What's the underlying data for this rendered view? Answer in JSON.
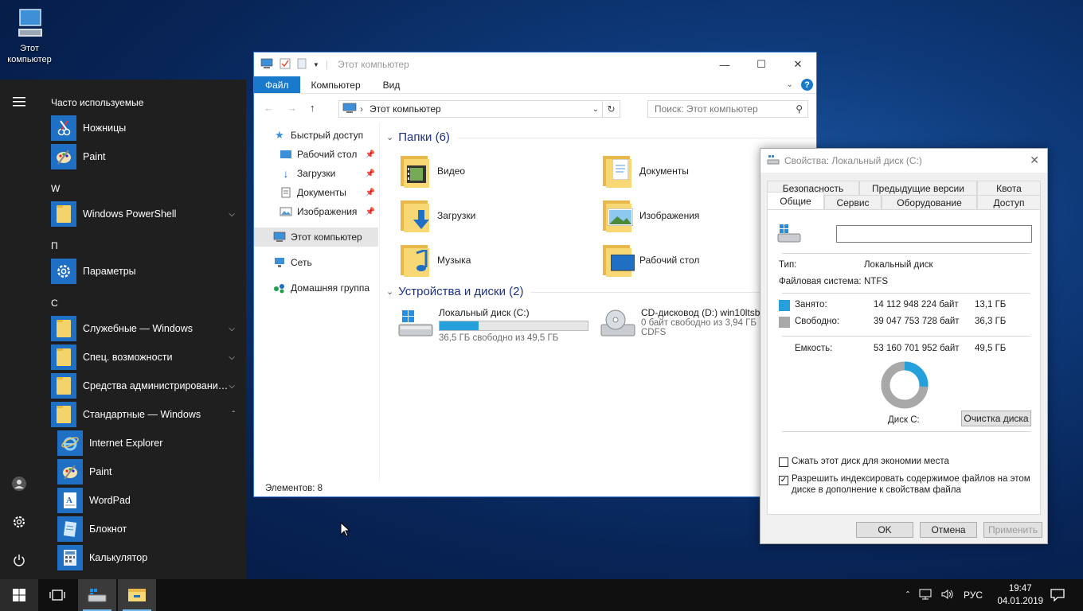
{
  "desktop": {
    "icon_label_1": "Этот",
    "icon_label_2": "компьютер"
  },
  "start_menu": {
    "header": "Часто используемые",
    "letters": [
      "W",
      "П",
      "С"
    ],
    "apps": [
      {
        "label": "Ножницы",
        "icon": "scissors-icon"
      },
      {
        "label": "Paint",
        "icon": "paint-icon"
      },
      {
        "label": "Windows PowerShell",
        "icon": "folder-icon"
      },
      {
        "label": "Параметры",
        "icon": "gear-icon"
      },
      {
        "label": "Служебные — Windows",
        "icon": "folder-icon"
      },
      {
        "label": "Спец. возможности",
        "icon": "folder-icon"
      },
      {
        "label": "Средства администрировани…",
        "icon": "folder-icon"
      },
      {
        "label": "Стандартные — Windows",
        "icon": "folder-icon"
      },
      {
        "label": "Internet Explorer",
        "icon": "ie-icon"
      },
      {
        "label": "Paint",
        "icon": "paint-icon"
      },
      {
        "label": "WordPad",
        "icon": "wordpad-icon"
      },
      {
        "label": "Блокнот",
        "icon": "notepad-icon"
      },
      {
        "label": "Калькулятор",
        "icon": "calculator-icon"
      }
    ]
  },
  "explorer": {
    "title": "Этот компьютер",
    "ribbon": {
      "file": "Файл",
      "computer": "Компьютер",
      "view": "Вид"
    },
    "address": "Этот компьютер",
    "search_placeholder": "Поиск: Этот компьютер",
    "nav": [
      "Быстрый доступ",
      "Рабочий стол",
      "Загрузки",
      "Документы",
      "Изображения",
      "Этот компьютер",
      "Сеть",
      "Домашняя группа"
    ],
    "folders_header": "Папки (6)",
    "folders": [
      "Видео",
      "Документы",
      "Загрузки",
      "Изображения",
      "Музыка",
      "Рабочий стол"
    ],
    "devices_header": "Устройства и диски (2)",
    "drive_c": {
      "name": "Локальный диск (C:)",
      "free": "36,5 ГБ свободно из 49,5 ГБ",
      "used_fraction": 0.263
    },
    "drive_d": {
      "name": "CD-дисковод (D:) win10ltsb_",
      "free": "0 байт свободно из 3,94 ГБ",
      "fs": "CDFS"
    },
    "status": "Элементов: 8"
  },
  "props": {
    "title": "Свойства: Локальный диск (C:)",
    "tabs_top": [
      "Безопасность",
      "Предыдущие версии",
      "Квота"
    ],
    "tabs_bottom": [
      "Общие",
      "Сервис",
      "Оборудование",
      "Доступ"
    ],
    "type_label": "Тип:",
    "type_value": "Локальный диск",
    "fs_label": "Файловая система:",
    "fs_value": "NTFS",
    "used_label": "Занято:",
    "used_bytes": "14 112 948 224 байт",
    "used_gb": "13,1 ГБ",
    "free_label": "Свободно:",
    "free_bytes": "39 047 753 728 байт",
    "free_gb": "36,3 ГБ",
    "cap_label": "Емкость:",
    "cap_bytes": "53 160 701 952 байт",
    "cap_gb": "49,5 ГБ",
    "disk_label": "Диск C:",
    "cleanup": "Очистка диска",
    "compress": "Сжать этот диск для экономии места",
    "index_1": "Разрешить индексировать содержимое файлов на этом",
    "index_2": "диске в дополнение к свойствам файла",
    "ok": "OK",
    "cancel": "Отмена",
    "apply": "Применить",
    "used_color": "#26a0da",
    "free_color": "#a8a8a8"
  },
  "taskbar": {
    "lang": "РУС",
    "time": "19:47",
    "date": "04.01.2019"
  }
}
